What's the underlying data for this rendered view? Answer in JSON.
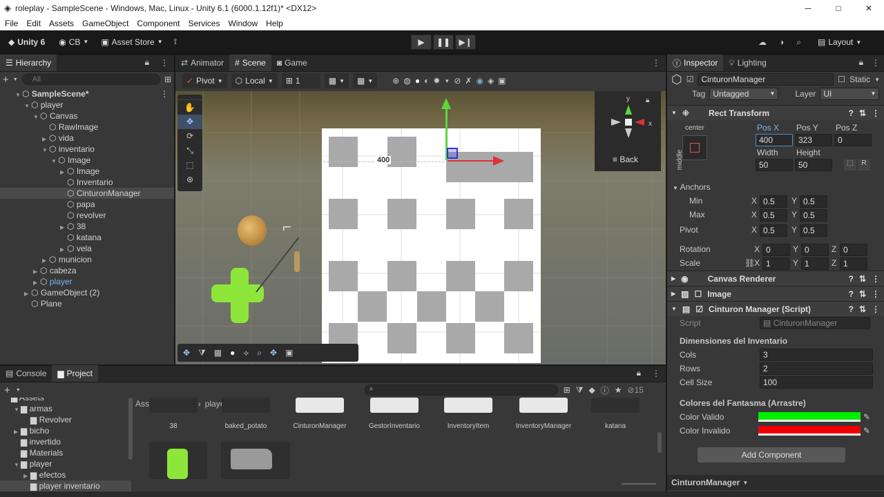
{
  "window": {
    "title": "roleplay - SampleScene - Windows, Mac, Linux - Unity 6.1 (6000.1.12f1)* <DX12>",
    "min": "─",
    "max": "□",
    "close": "✕"
  },
  "menu": [
    "File",
    "Edit",
    "Assets",
    "GameObject",
    "Component",
    "Services",
    "Window",
    "Help"
  ],
  "toolbar": {
    "unity": "Unity 6",
    "account": "CB",
    "store": "Asset Store",
    "layout": "Layout"
  },
  "hierarchy": {
    "tab": "Hierarchy",
    "search_placeholder": "All",
    "scene": "SampleScene*",
    "items": [
      {
        "label": "player",
        "indent": 1,
        "arrow": "▼"
      },
      {
        "label": "Canvas",
        "indent": 2,
        "arrow": "▼"
      },
      {
        "label": "RawImage",
        "indent": 3,
        "arrow": ""
      },
      {
        "label": "vida",
        "indent": 3,
        "arrow": "▶"
      },
      {
        "label": "inventario",
        "indent": 3,
        "arrow": "▼"
      },
      {
        "label": "Image",
        "indent": 4,
        "arrow": "▼"
      },
      {
        "label": "Image",
        "indent": 5,
        "arrow": "▶"
      },
      {
        "label": "Inventario",
        "indent": 5,
        "arrow": ""
      },
      {
        "label": "CinturonManager",
        "indent": 5,
        "arrow": "",
        "selected": true
      },
      {
        "label": "papa",
        "indent": 5,
        "arrow": ""
      },
      {
        "label": "revolver",
        "indent": 5,
        "arrow": ""
      },
      {
        "label": "38",
        "indent": 5,
        "arrow": "▶"
      },
      {
        "label": "katana",
        "indent": 5,
        "arrow": ""
      },
      {
        "label": "vela",
        "indent": 5,
        "arrow": "▶"
      },
      {
        "label": "municion",
        "indent": 3,
        "arrow": "▶"
      },
      {
        "label": "cabeza",
        "indent": 2,
        "arrow": "▶"
      },
      {
        "label": "player",
        "indent": 2,
        "arrow": "▶",
        "blue": true
      },
      {
        "label": "GameObject (2)",
        "indent": 1,
        "arrow": "▶"
      },
      {
        "label": "Plane",
        "indent": 1,
        "arrow": ""
      }
    ]
  },
  "scene_tabs": [
    "Animator",
    "Scene",
    "Game"
  ],
  "scene_toolbar": {
    "pivot": "Pivot",
    "local": "Local",
    "step": "1"
  },
  "scene": {
    "pos_label": "400",
    "gizmo_back": "Back",
    "axis_y": "y",
    "axis_x": "x"
  },
  "inspector": {
    "tabs": [
      "Inspector",
      "Lighting"
    ],
    "object": "CinturonManager",
    "static": "Static",
    "tag_label": "Tag",
    "tag": "Untagged",
    "layer_label": "Layer",
    "layer": "UI",
    "rect": {
      "title": "Rect Transform",
      "anchor_h": "center",
      "anchor_v": "middle",
      "posx_l": "Pos X",
      "posy_l": "Pos Y",
      "posz_l": "Pos Z",
      "posx": "400",
      "posy": "323",
      "posz": "0",
      "w_l": "Width",
      "h_l": "Height",
      "w": "50",
      "h": "50",
      "r": "R",
      "anchors": "Anchors",
      "min": "Min",
      "max": "Max",
      "pivot": "Pivot",
      "x": "X",
      "y": "Y",
      "z": "Z",
      "v05": "0.5",
      "rotation": "Rotation",
      "scale": "Scale",
      "zero": "0",
      "one": "1"
    },
    "canvas_renderer": "Canvas Renderer",
    "image": "Image",
    "script_comp": "Cinturon Manager (Script)",
    "script_l": "Script",
    "script": "CinturonManager",
    "dim_title": "Dimensiones del Inventario",
    "cols_l": "Cols",
    "cols": "3",
    "rows_l": "Rows",
    "rows": "2",
    "cell_l": "Cell Size",
    "cell": "100",
    "colors_title": "Colores del Fantasma (Arrastre)",
    "valid_l": "Color Valido",
    "invalid_l": "Color Invalido",
    "add": "Add Component",
    "footer": "CinturonManager"
  },
  "bottom": {
    "tabs": [
      "Console",
      "Project"
    ],
    "count": "15",
    "breadcrumb": [
      "Assets",
      "player",
      "player inventario"
    ],
    "tree": [
      {
        "label": "Assets",
        "indent": 0
      },
      {
        "label": "armas",
        "indent": 1,
        "arrow": "▼"
      },
      {
        "label": "Revolver",
        "indent": 2
      },
      {
        "label": "bicho",
        "indent": 1,
        "arrow": "▶"
      },
      {
        "label": "invertido",
        "indent": 1
      },
      {
        "label": "Materials",
        "indent": 1
      },
      {
        "label": "player",
        "indent": 1,
        "arrow": "▼"
      },
      {
        "label": "efectos",
        "indent": 2,
        "arrow": "▶"
      },
      {
        "label": "player inventario",
        "indent": 2,
        "selected": true
      }
    ],
    "assets": [
      "38",
      "baked_potato",
      "CinturonManager",
      "GestorInventario",
      "InventoryItem",
      "InventoryManager",
      "katana"
    ]
  },
  "colors": {
    "green": "#00ee00",
    "red": "#ee0000",
    "accent": "#4a8fd8",
    "selection": "#2c5d87"
  },
  "icons": [
    "hand-icon",
    "move-icon",
    "rotate-icon",
    "scale-icon",
    "rect-icon",
    "transform-icon",
    "play-icon",
    "pause-icon",
    "step-icon",
    "cloud-icon",
    "search-icon",
    "lock-icon",
    "gear-icon"
  ]
}
